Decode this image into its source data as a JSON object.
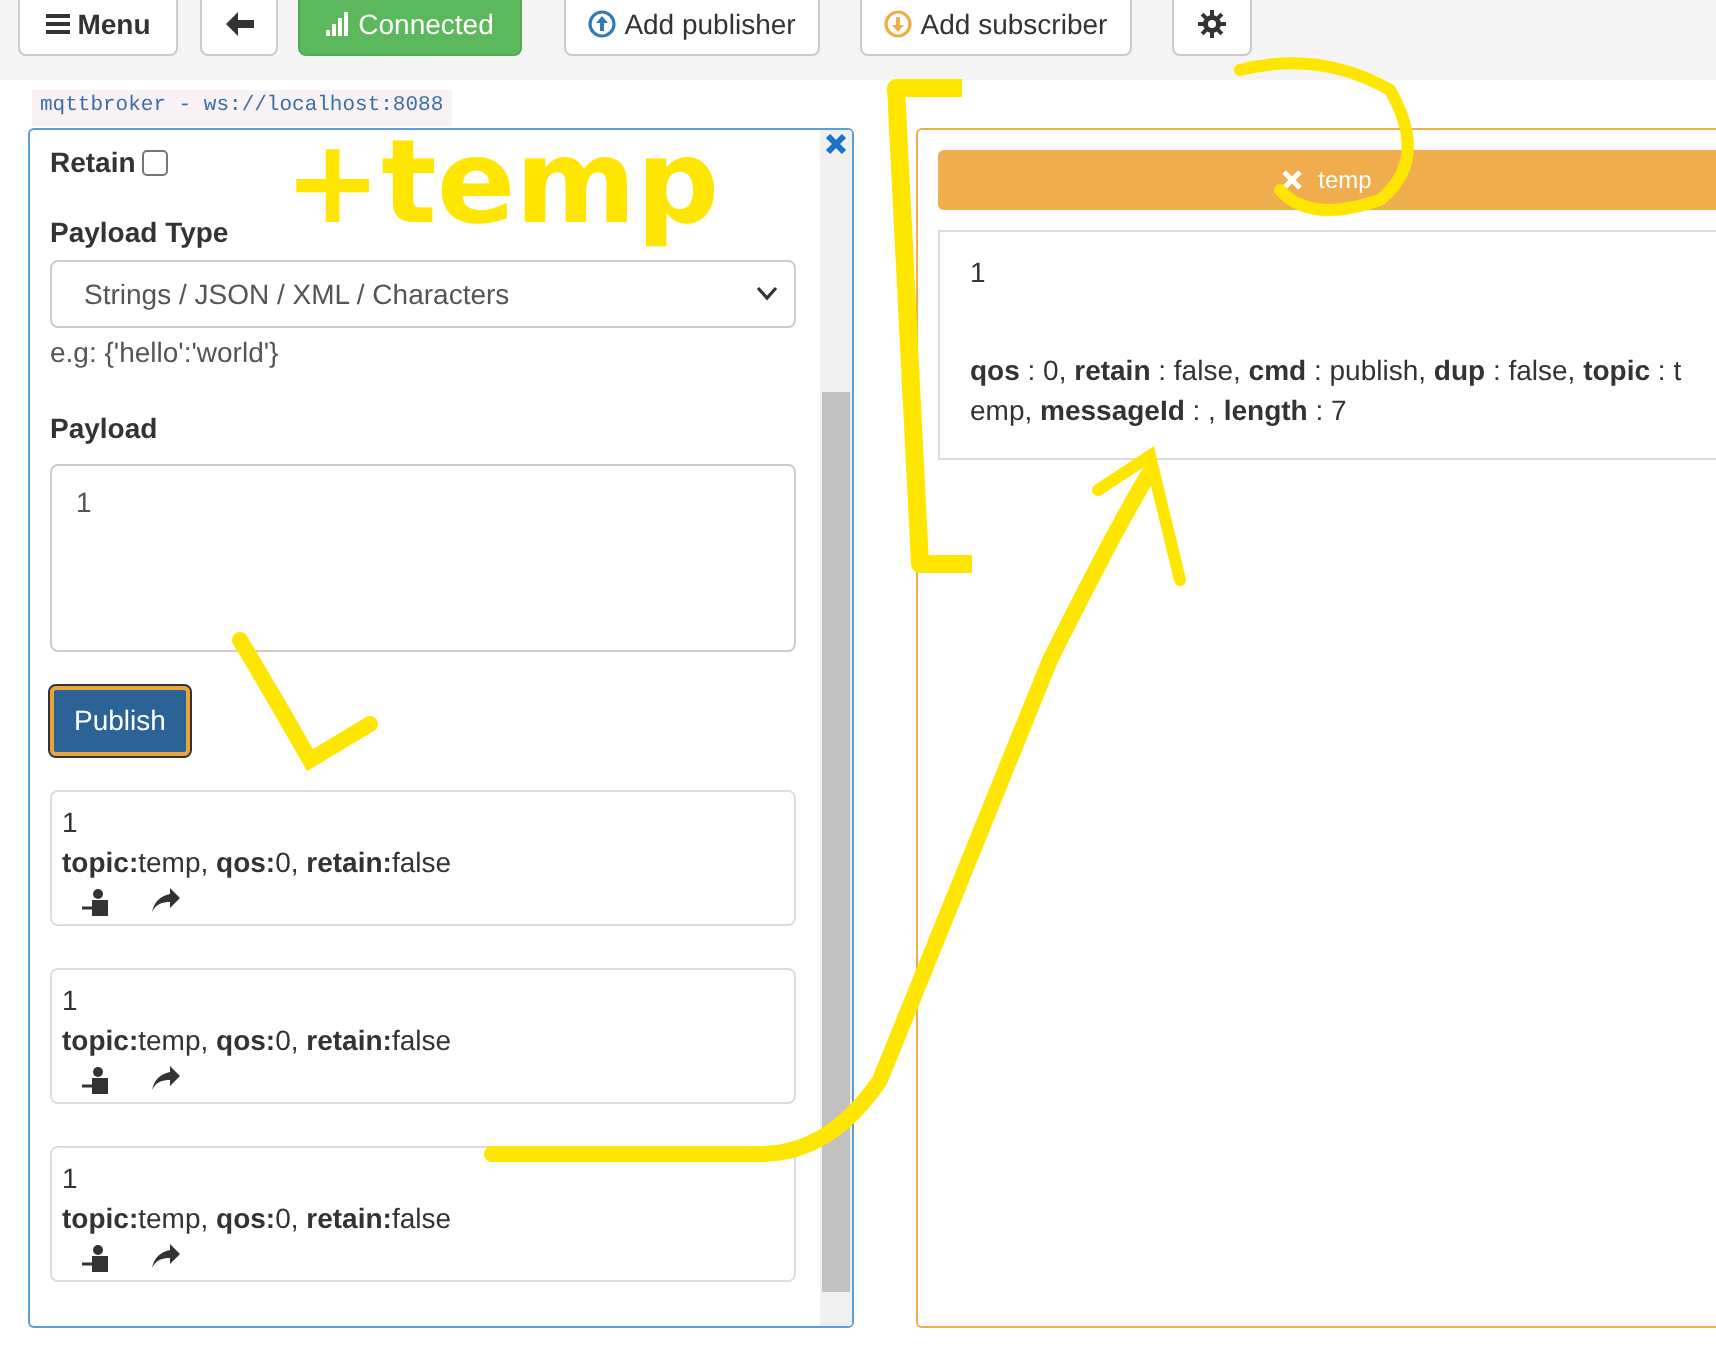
{
  "toolbar": {
    "buttons": [
      {
        "kind": "menu",
        "label": "Menu"
      },
      {
        "kind": "back"
      },
      {
        "kind": "status",
        "label": "Connected"
      },
      {
        "kind": "add-publisher",
        "label": "Add publisher"
      },
      {
        "kind": "add-subscriber",
        "label": "Add subscriber"
      },
      {
        "kind": "settings"
      }
    ]
  },
  "broker_label": "mqttbroker - ws://localhost:8088",
  "publisher": {
    "retain": {
      "label": "Retain",
      "checked": false
    },
    "payload_type": {
      "label": "Payload Type",
      "value": "Strings / JSON / XML / Characters",
      "hint": "e.g: {'hello':'world'}"
    },
    "payload": {
      "label": "Payload",
      "value": "1"
    },
    "publish_button": "Publish",
    "messages": [
      {
        "payload": "1",
        "meta": "**topic:**temp, **qos:**0, **retain:**false"
      },
      {
        "payload": "1",
        "meta": "**topic:**temp, **qos:**0, **retain:**false"
      },
      {
        "payload": "1",
        "meta": "**topic:**temp, **qos:**0, **retain:**false"
      }
    ]
  },
  "subscriber": {
    "topic": "temp",
    "messages": [
      {
        "payload": "1",
        "meta": "**qos** : 0, **retain** : false, **cmd** : publish, **dup** : false, **topic** : temp, **messageId** : , **length** : 7"
      }
    ]
  },
  "annotations": [
    {
      "text": "+temp"
    }
  ]
}
